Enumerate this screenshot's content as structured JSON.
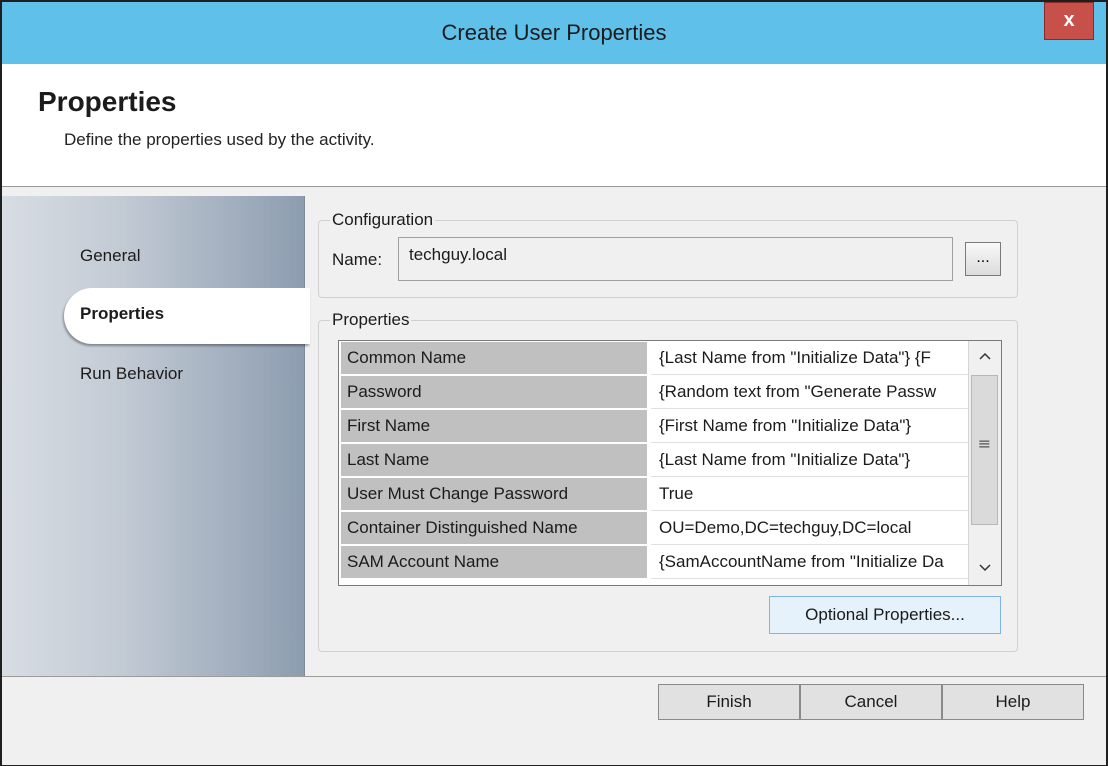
{
  "window": {
    "title": "Create User Properties",
    "close_label": "x"
  },
  "header": {
    "title": "Properties",
    "description": "Define the properties used by the activity."
  },
  "sidebar": {
    "items": [
      {
        "label": "General",
        "active": false
      },
      {
        "label": "Properties",
        "active": true
      },
      {
        "label": "Run Behavior",
        "active": false
      }
    ]
  },
  "configuration": {
    "group_label": "Configuration",
    "name_label": "Name:",
    "name_value": "techguy.local",
    "browse_label": "..."
  },
  "properties": {
    "group_label": "Properties",
    "rows": [
      {
        "name": "Common Name",
        "value": "{Last Name from \"Initialize Data\"} {F"
      },
      {
        "name": "Password",
        "value": "{Random text from \"Generate Passw"
      },
      {
        "name": "First Name",
        "value": "{First Name from \"Initialize Data\"}"
      },
      {
        "name": "Last Name",
        "value": "{Last Name from \"Initialize Data\"}"
      },
      {
        "name": "User Must Change Password",
        "value": "True"
      },
      {
        "name": "Container Distinguished Name",
        "value": "OU=Demo,DC=techguy,DC=local"
      },
      {
        "name": "SAM Account Name",
        "value": "{SamAccountName from \"Initialize Da"
      }
    ],
    "optional_button": "Optional Properties..."
  },
  "footer": {
    "finish": "Finish",
    "cancel": "Cancel",
    "help": "Help"
  },
  "colors": {
    "titlebar": "#5fc0ea",
    "close": "#c7504b",
    "name_cell": "#c0c0c0"
  },
  "icons": {
    "scroll_up": "chevron-up-icon",
    "scroll_down": "chevron-down-icon",
    "scroll_grip": "grip-icon"
  }
}
